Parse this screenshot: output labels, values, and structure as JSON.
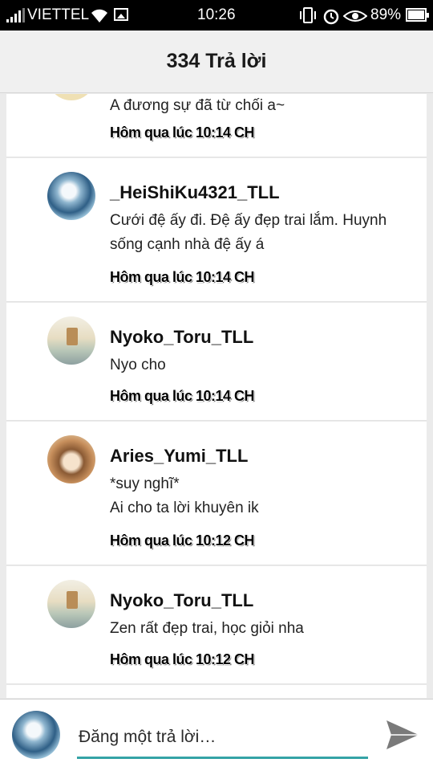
{
  "status_bar": {
    "carrier": "VIETTEL",
    "time": "10:26",
    "battery": "89%",
    "battery_level": 0.89,
    "icons": [
      "signal-icon",
      "wifi-icon",
      "image-icon",
      "vibrate-icon",
      "alarm-icon",
      "eye-icon",
      "battery-icon"
    ]
  },
  "header": {
    "title": "334 Trả lời"
  },
  "replies": [
    {
      "author": "",
      "text": "A đương sự đã từ chối a~",
      "time": "Hôm qua lúc 10:14 CH"
    },
    {
      "author": "_HeiShiKu4321_TLL",
      "text": "Cưới đệ ấy đi. Đệ ấy đẹp trai lắm. Huynh sống cạnh nhà đệ ấy á",
      "time": "Hôm qua lúc 10:14 CH"
    },
    {
      "author": "Nyoko_Toru_TLL",
      "text": "Nyo cho",
      "time": "Hôm qua lúc 10:14 CH"
    },
    {
      "author": "Aries_Yumi_TLL",
      "text_line1": "*suy nghĩ*",
      "text_line2": "Ai cho ta lời khuyên ik",
      "time": "Hôm qua lúc 10:12 CH"
    },
    {
      "author": "Nyoko_Toru_TLL",
      "text": "Zen rất đẹp trai, học giỏi nha",
      "time": "Hôm qua lúc 10:12 CH"
    }
  ],
  "composer": {
    "placeholder": "Đăng một trả lời…",
    "send_icon": "send-icon"
  },
  "colors": {
    "accent": "#34a3a6",
    "header_bg": "#f0f0f0",
    "status_bg": "#000000"
  }
}
